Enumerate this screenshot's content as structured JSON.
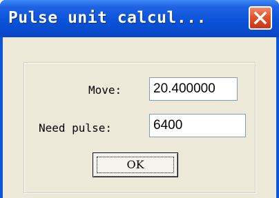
{
  "window": {
    "title": "Pulse unit calcul...",
    "close_icon": "close-icon"
  },
  "form": {
    "move": {
      "label": "Move:",
      "value": "20.400000"
    },
    "need_pulse": {
      "label": "Need pulse:",
      "value": "6400"
    }
  },
  "buttons": {
    "ok_label": "OK"
  },
  "colors": {
    "titlebar": "#0a53d9",
    "close_button": "#e2542c",
    "dialog_background": "#ece9d8",
    "field_border": "#7f9db9"
  }
}
